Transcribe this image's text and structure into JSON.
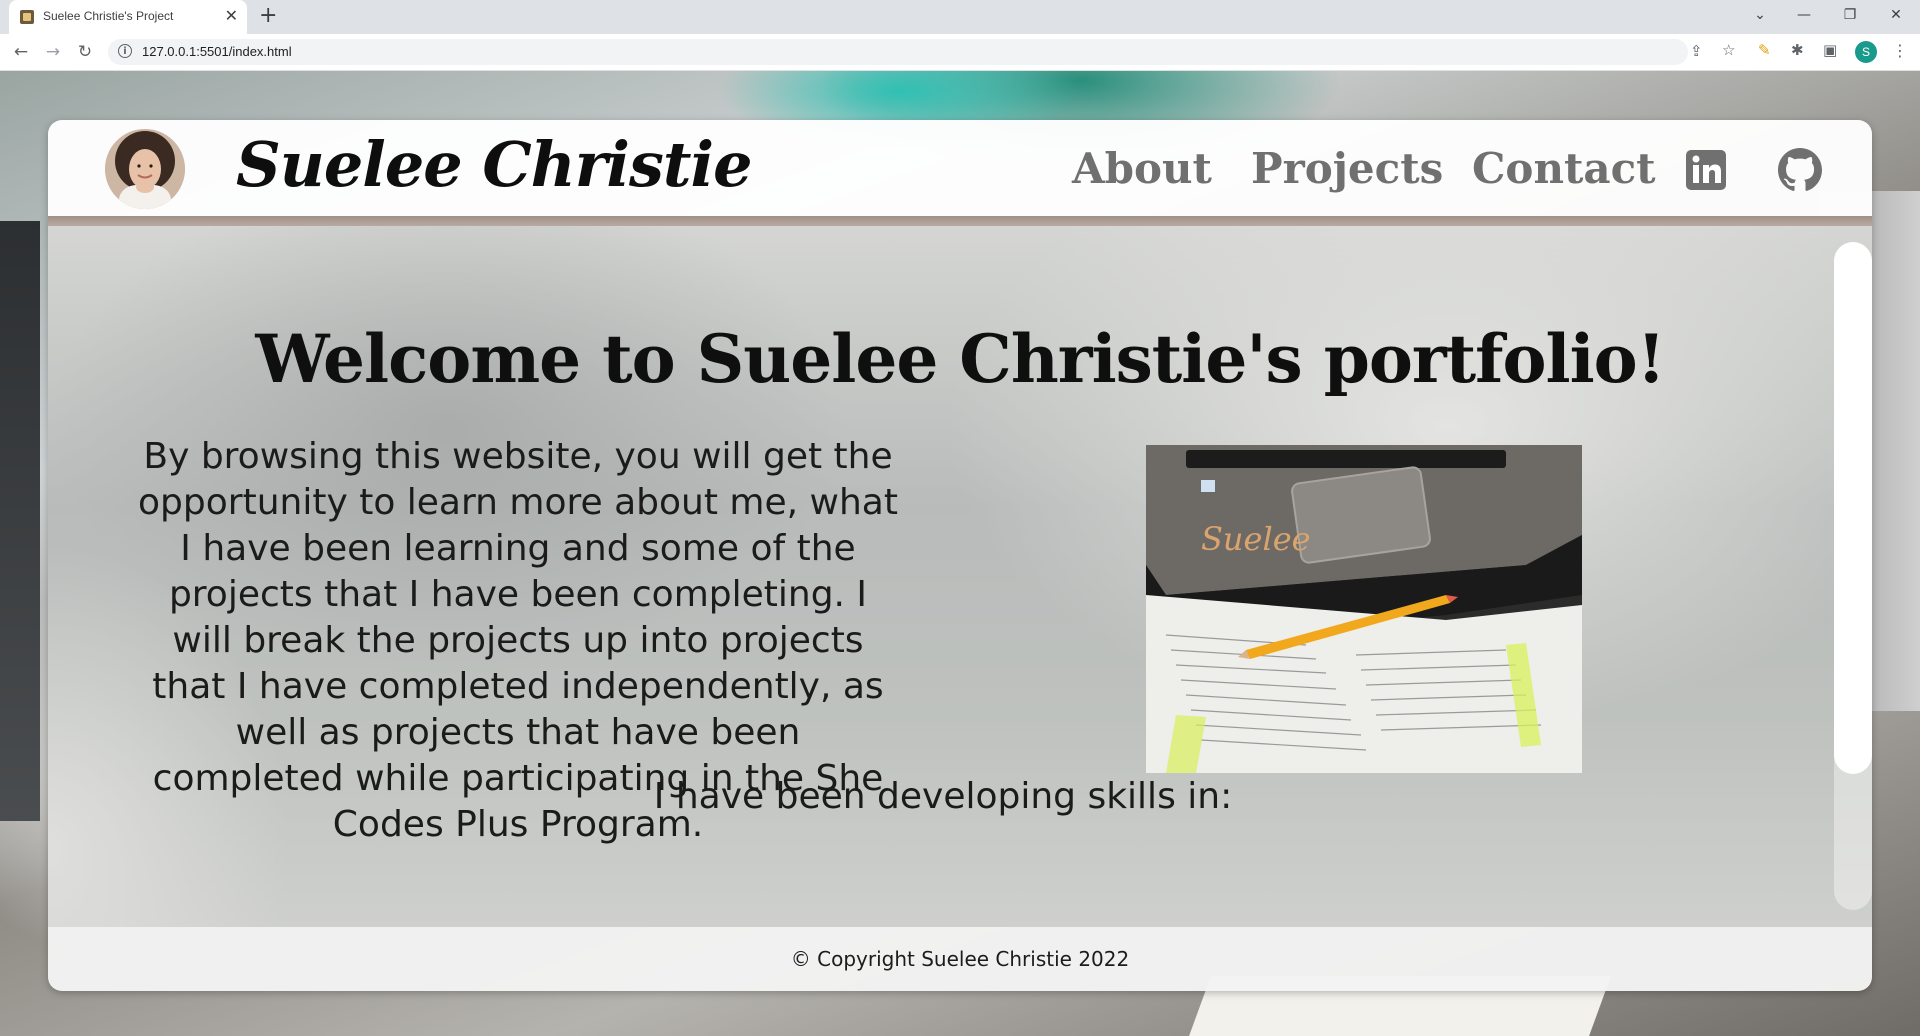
{
  "browser": {
    "tab_title": "Suelee Christie's Project",
    "tab_close": "✕",
    "new_tab": "+",
    "url": "127.0.0.1:5501/index.html",
    "profile_initial": "S",
    "window_controls": [
      "⌄",
      "—",
      "❐",
      "✕"
    ]
  },
  "site": {
    "brand": "Suelee Christie",
    "nav": [
      "About",
      "Projects",
      "Contact"
    ],
    "social": [
      "linkedin-icon",
      "github-icon"
    ],
    "headline": "Welcome to Suelee Christie's portfolio!",
    "intro": "By browsing this website, you will get the opportunity to learn more about me, what I have been learning and some of the projects that I have been completing. I will break the projects up into projects that I have completed independently, as well as projects that have been completed while participating in the She Codes Plus Program.",
    "photo_signature": "Suelee",
    "skills_heading": "I have been developing skills in:",
    "footer": "© Copyright Suelee Christie 2022"
  },
  "colors": {
    "nav_link": "#707070",
    "brand": "#0e0e0e",
    "profile_bg": "#1a9a8c"
  }
}
